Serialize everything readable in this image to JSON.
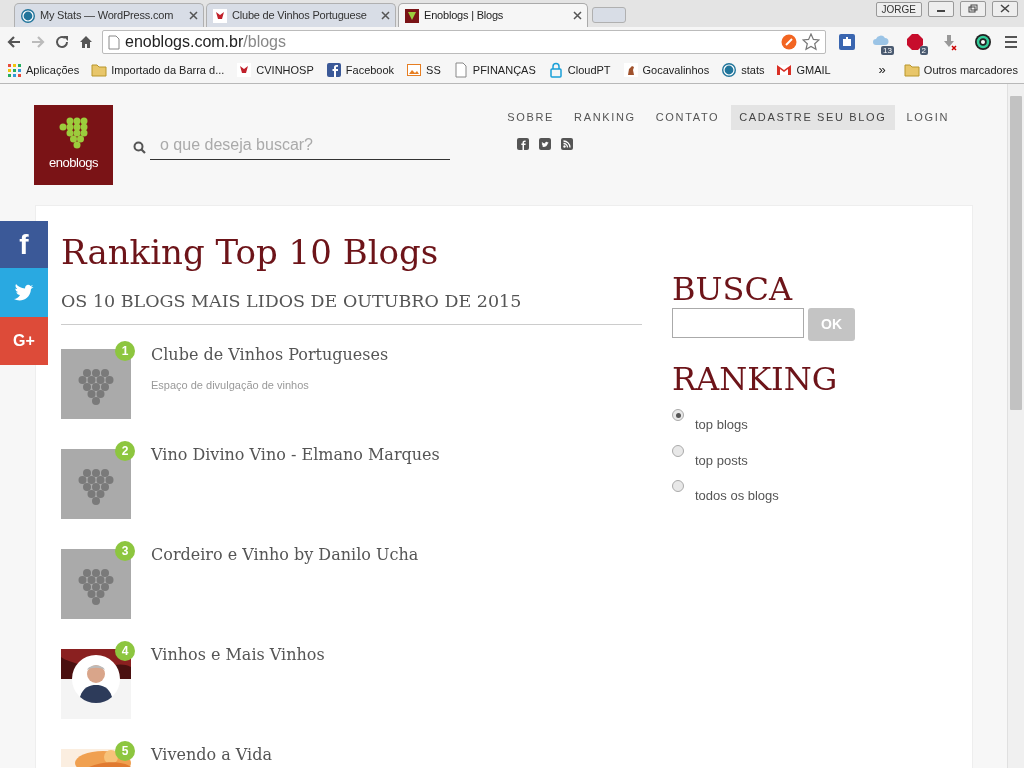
{
  "browser": {
    "tabs": [
      {
        "title": "My Stats — WordPress.com",
        "kind": "wordpress",
        "selected": false
      },
      {
        "title": "Clube de Vinhos Portuguese",
        "kind": "cvinho",
        "selected": false
      },
      {
        "title": "Enoblogs | Blogs",
        "kind": "enoblogs",
        "selected": true
      }
    ],
    "user": "JORGE",
    "address": {
      "host": "enoblogs.com.br",
      "path": "/blogs"
    },
    "extensions": [
      {
        "kind": "puzzle"
      },
      {
        "kind": "cloud",
        "badge": "13"
      },
      {
        "kind": "abp",
        "badge": "2"
      },
      {
        "kind": "download"
      },
      {
        "kind": "circle"
      }
    ],
    "bookmarks": [
      {
        "label": "Aplicações",
        "kind": "apps"
      },
      {
        "label": "Importado da Barra d...",
        "kind": "folder"
      },
      {
        "label": "CVINHOSP",
        "kind": "cvinho"
      },
      {
        "label": "Facebook",
        "kind": "facebook"
      },
      {
        "label": "SS",
        "kind": "ss"
      },
      {
        "label": "PFINANÇAS",
        "kind": "page"
      },
      {
        "label": "CloudPT",
        "kind": "lock"
      },
      {
        "label": "Gocavalinhos",
        "kind": "goca"
      },
      {
        "label": "stats",
        "kind": "wordpress"
      },
      {
        "label": "GMAIL",
        "kind": "gmail"
      }
    ],
    "more": "»",
    "other_bookmarks": "Outros marcadores"
  },
  "site": {
    "logo": "enoblogs",
    "search": {
      "placeholder": "o que deseja buscar?"
    },
    "nav": [
      {
        "label": "SOBRE",
        "highlighted": false
      },
      {
        "label": "RANKING",
        "highlighted": false
      },
      {
        "label": "CONTATO",
        "highlighted": false
      },
      {
        "label": "CADASTRE SEU BLOG",
        "highlighted": true
      },
      {
        "label": "LOGIN",
        "highlighted": false
      }
    ],
    "social": [
      {
        "kind": "facebook"
      },
      {
        "kind": "twitter"
      },
      {
        "kind": "rss"
      }
    ],
    "share": [
      {
        "kind": "facebook",
        "glyph": "f"
      },
      {
        "kind": "twitter"
      },
      {
        "kind": "googleplus",
        "glyph": "G+"
      }
    ]
  },
  "main": {
    "title": "Ranking Top 10 Blogs",
    "subtitle": "OS 10 BLOGS MAIS LIDOS DE OUTUBRO DE 2015",
    "blogs": [
      {
        "rank": "1",
        "title": "Clube de Vinhos Portugueses",
        "description": "Espaço de divulgação de vinhos",
        "kind": "grapes"
      },
      {
        "rank": "2",
        "title": "Vino Divino Vino - Elmano Marques",
        "kind": "grapes"
      },
      {
        "rank": "3",
        "title": "Cordeiro e Vinho by Danilo Ucha",
        "kind": "grapes"
      },
      {
        "rank": "4",
        "title": "Vinhos e Mais Vinhos",
        "kind": "picture"
      },
      {
        "rank": "5",
        "title": "Vivendo a Vida",
        "kind": "picture"
      }
    ]
  },
  "sidebar": {
    "search": {
      "title": "BUSCA",
      "button": "OK"
    },
    "ranking": {
      "title": "RANKING",
      "options": [
        {
          "label": "top blogs",
          "selected": true
        },
        {
          "label": "top posts",
          "selected": false
        },
        {
          "label": "todos os blogs",
          "selected": false
        }
      ]
    }
  }
}
